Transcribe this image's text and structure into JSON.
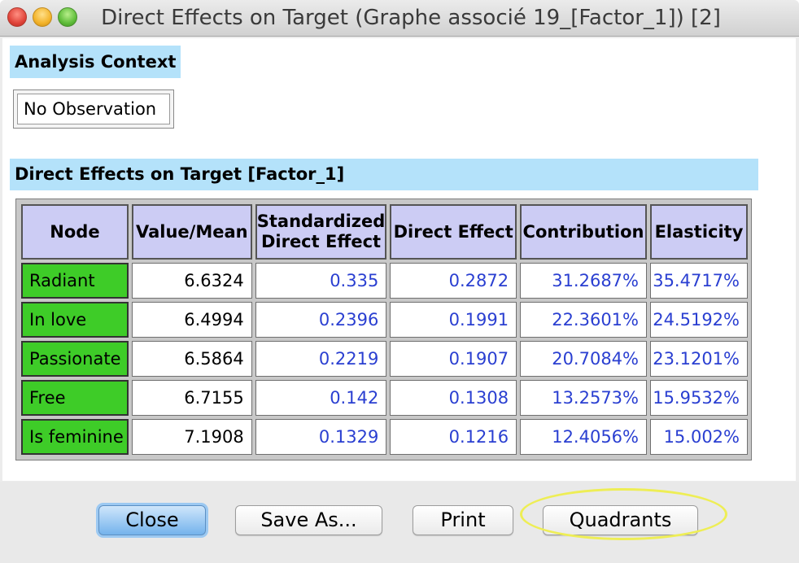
{
  "window": {
    "title": "Direct Effects on Target (Graphe associé 19_[Factor_1]) [2]"
  },
  "analysis_context": {
    "label": "Analysis Context",
    "value": "No Observation"
  },
  "table_section": {
    "label": "Direct Effects on Target [Factor_1]",
    "headers": [
      "Node",
      "Value/Mean",
      "Standardized",
      "Direct Effect",
      "Direct Effect",
      "Contribution",
      "Elasticity"
    ],
    "rows": [
      {
        "node": "Radiant",
        "value_mean": "6.6324",
        "standardized": "0.335",
        "direct_effect": "0.2872",
        "contribution": "31.2687%",
        "elasticity": "35.4717%"
      },
      {
        "node": "In love",
        "value_mean": "6.4994",
        "standardized": "0.2396",
        "direct_effect": "0.1991",
        "contribution": "22.3601%",
        "elasticity": "24.5192%"
      },
      {
        "node": "Passionate",
        "value_mean": "6.5864",
        "standardized": "0.2219",
        "direct_effect": "0.1907",
        "contribution": "20.7084%",
        "elasticity": "23.1201%"
      },
      {
        "node": "Free",
        "value_mean": "6.7155",
        "standardized": "0.142",
        "direct_effect": "0.1308",
        "contribution": "13.2573%",
        "elasticity": "15.9532%"
      },
      {
        "node": "Is feminine",
        "value_mean": "7.1908",
        "standardized": "0.1329",
        "direct_effect": "0.1216",
        "contribution": "12.4056%",
        "elasticity": "15.002%"
      }
    ]
  },
  "buttons": {
    "close": "Close",
    "save_as": "Save As...",
    "print": "Print",
    "quadrants": "Quadrants"
  },
  "colors": {
    "section_label_bg": "#b4e2fa",
    "header_bg": "#ccccf4",
    "node_bg": "#3ecc28",
    "number_text": "#2a3fd1",
    "highlight": "#eeee55"
  }
}
